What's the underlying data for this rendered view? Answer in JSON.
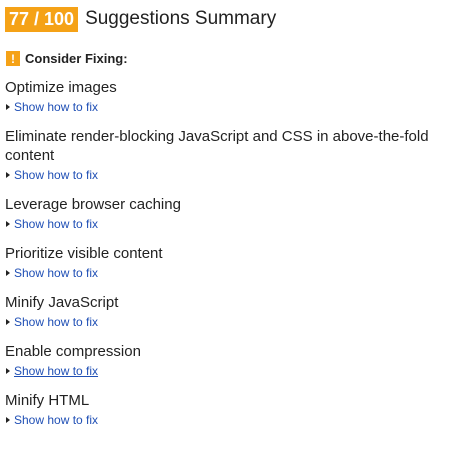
{
  "header": {
    "score": "77 / 100",
    "title": "Suggestions Summary"
  },
  "section": {
    "icon_glyph": "!",
    "icon": "warning-icon",
    "label": "Consider Fixing:"
  },
  "rules": [
    {
      "title": "Optimize images",
      "link": "Show how to fix"
    },
    {
      "title": "Eliminate render-blocking JavaScript and CSS in above-the-fold content",
      "link": "Show how to fix"
    },
    {
      "title": "Leverage browser caching",
      "link": "Show how to fix"
    },
    {
      "title": "Prioritize visible content",
      "link": "Show how to fix"
    },
    {
      "title": "Minify JavaScript",
      "link": "Show how to fix"
    },
    {
      "title": "Enable compression",
      "link": "Show how to fix"
    },
    {
      "title": "Minify HTML",
      "link": "Show how to fix"
    }
  ],
  "colors": {
    "accent": "#f5a217",
    "link": "#1f4fb5",
    "text": "#222222"
  }
}
